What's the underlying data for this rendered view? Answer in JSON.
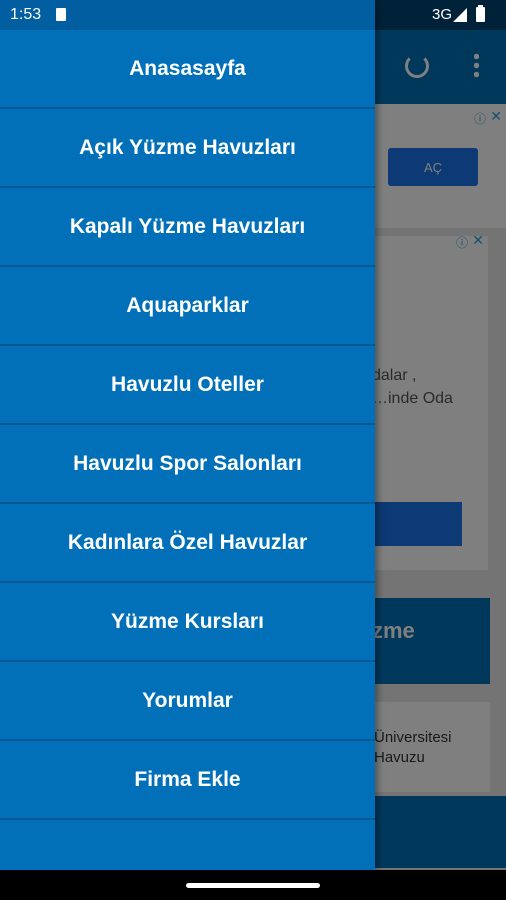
{
  "status_bar": {
    "time": "1:53",
    "network": "3G"
  },
  "background": {
    "ad_button": "AÇ",
    "ad_text": "dalar ,\n…inde Oda",
    "banner_text": "zme",
    "list_line1": "Üniversitesi",
    "list_line2": "Havuzu",
    "ad_info_glyph": "ⓘ",
    "ad_close_glyph": "✕"
  },
  "drawer": {
    "items": [
      "Anasasayfa",
      "Açık Yüzme Havuzları",
      "Kapalı Yüzme Havuzları",
      "Aquaparklar",
      "Havuzlu Oteller",
      "Havuzlu Spor Salonları",
      "Kadınlara Özel Havuzlar",
      "Yüzme Kursları",
      "Yorumlar",
      "Firma Ekle"
    ]
  },
  "colors": {
    "accent": "#0170b9",
    "ad_button": "#1a73e8"
  }
}
